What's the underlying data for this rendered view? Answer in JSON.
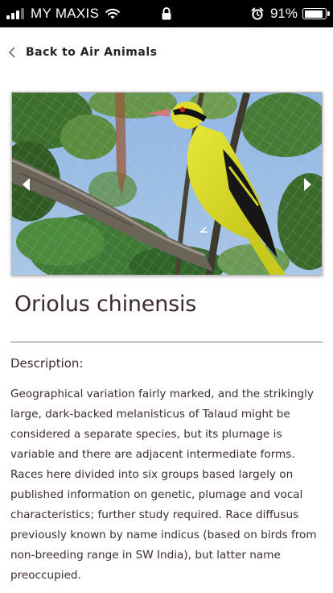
{
  "status_bar": {
    "carrier": "MY MAXIS",
    "battery": "91%",
    "battery_level": 0.91,
    "signal_bars_active": 3,
    "signal_bars_total": 4,
    "icons": [
      "signal-icon",
      "wifi-icon",
      "lock-icon",
      "alarm-icon",
      "battery-icon"
    ]
  },
  "nav": {
    "back_label": "Back to Air Animals",
    "back_icon": "chevron-left-icon"
  },
  "gallery": {
    "image_subject": "oriole-photo",
    "prev_icon": "caret-left-icon",
    "next_icon": "caret-right-icon"
  },
  "species": {
    "name": "Oriolus chinensis",
    "description_label": "Description:",
    "description": "Geographical variation fairly marked, and the strikingly large, dark-backed melanisticus of Talaud might be considered a separate species, but its plumage is variable and there are adjacent intermediate forms. Races here divided into six groups based largely on published information on genetic, plumage and vocal characteristics; further study required. Race diffusus previously known by name indicus (based on birds from non-breeding range in SW India), but latter name preoccupied."
  },
  "colors": {
    "status_bar_bg": "#000000",
    "text": "#3b2b2e",
    "divider": "#7a7a7a",
    "bird_yellow": "#d8d81e"
  }
}
